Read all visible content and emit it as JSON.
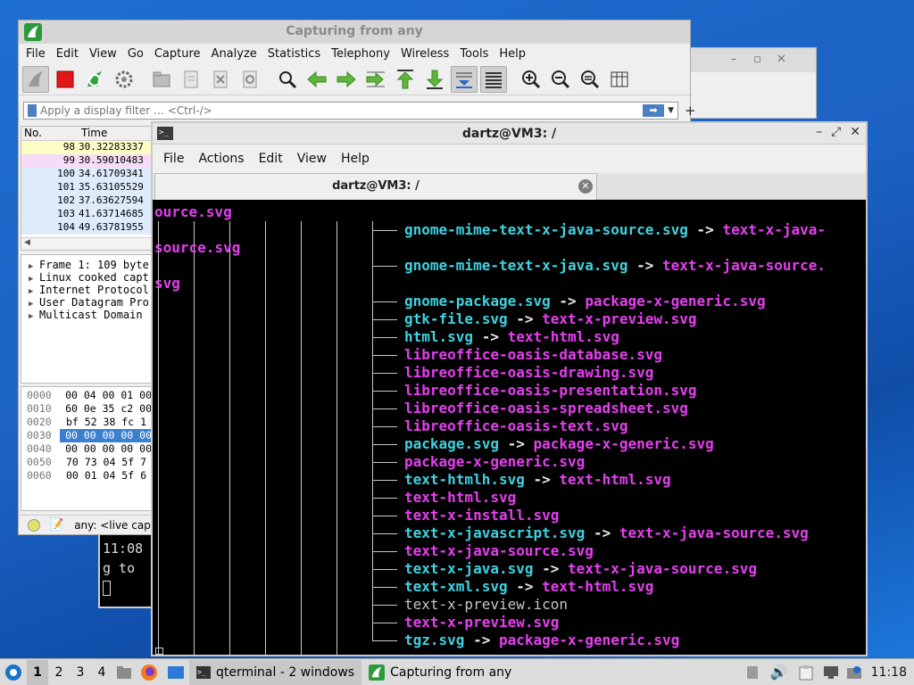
{
  "wireshark": {
    "title": "Capturing from any",
    "menu": [
      "File",
      "Edit",
      "View",
      "Go",
      "Capture",
      "Analyze",
      "Statistics",
      "Telephony",
      "Wireless",
      "Tools",
      "Help"
    ],
    "filter_placeholder": "Apply a display filter … <Ctrl-/>",
    "columns": [
      "No.",
      "Time"
    ],
    "packets": [
      {
        "no": "98",
        "time": "30.32283337",
        "color": "#fdfdc6"
      },
      {
        "no": "99",
        "time": "30.59010483",
        "color": "#f6dcf6"
      },
      {
        "no": "100",
        "time": "34.61709341",
        "color": "#ddebfb"
      },
      {
        "no": "101",
        "time": "35.63105529",
        "color": "#ddebfb"
      },
      {
        "no": "102",
        "time": "37.63627594",
        "color": "#ddebfb"
      },
      {
        "no": "103",
        "time": "41.63714685",
        "color": "#ddebfb"
      },
      {
        "no": "104",
        "time": "49.63781955",
        "color": "#ddebfb"
      }
    ],
    "details": [
      "Frame 1: 109 byte",
      "Linux cooked capt",
      "Internet Protocol",
      "User Datagram Pro",
      "Multicast Domain"
    ],
    "bytes": [
      {
        "off": "0000",
        "hex": "00 04 00 01 00"
      },
      {
        "off": "0010",
        "hex": "60 0e 35 c2 00"
      },
      {
        "off": "0020",
        "hex": "bf 52 38 fc 1"
      },
      {
        "off": "0030",
        "hex": "00 00 00 00 00",
        "sel": true
      },
      {
        "off": "0040",
        "hex": "00 00 00 00 00"
      },
      {
        "off": "0050",
        "hex": "70 73 04 5f 7"
      },
      {
        "off": "0060",
        "hex": "00 01 04 5f 6"
      }
    ],
    "status_text": "any: <live cap"
  },
  "bg_terminal": {
    "line1": "11:08",
    "line2": "g to"
  },
  "qterminal": {
    "title": "dartz@VM3: /",
    "menu": [
      "File",
      "Actions",
      "Edit",
      "View",
      "Help"
    ],
    "tab_label": "dartz@VM3: /",
    "lines": [
      {
        "link": "",
        "target": "ource.svg",
        "cont": true
      },
      {
        "link": "gnome-mime-text-x-java-source.svg",
        "target": "text-x-java-"
      },
      {
        "link": "",
        "target": "source.svg",
        "cont": true
      },
      {
        "link": "gnome-mime-text-x-java.svg",
        "target": "text-x-java-source."
      },
      {
        "link": "",
        "target": "svg",
        "cont": true
      },
      {
        "link": "gnome-package.svg",
        "target": "package-x-generic.svg"
      },
      {
        "link": "gtk-file.svg",
        "target": "text-x-preview.svg"
      },
      {
        "link": "html.svg",
        "target": "text-html.svg"
      },
      {
        "file": "libreoffice-oasis-database.svg"
      },
      {
        "file": "libreoffice-oasis-drawing.svg"
      },
      {
        "file": "libreoffice-oasis-presentation.svg"
      },
      {
        "file": "libreoffice-oasis-spreadsheet.svg"
      },
      {
        "file": "libreoffice-oasis-text.svg"
      },
      {
        "link": "package.svg",
        "target": "package-x-generic.svg"
      },
      {
        "file": "package-x-generic.svg"
      },
      {
        "link": "text-htmlh.svg",
        "target": "text-html.svg"
      },
      {
        "file": "text-html.svg"
      },
      {
        "file": "text-x-install.svg"
      },
      {
        "link": "text-x-javascript.svg",
        "target": "text-x-java-source.svg"
      },
      {
        "file": "text-x-java-source.svg"
      },
      {
        "link": "text-x-java.svg",
        "target": "text-x-java-source.svg"
      },
      {
        "link": "text-xml.svg",
        "target": "text-html.svg"
      },
      {
        "plain": "text-x-preview.icon"
      },
      {
        "file": "text-x-preview.svg"
      },
      {
        "link": "tgz.svg",
        "target": "package-x-generic.svg"
      }
    ],
    "arrow": "->"
  },
  "taskbar": {
    "workspaces": [
      "1",
      "2",
      "3",
      "4"
    ],
    "tasks": [
      "qterminal - 2 windows",
      "Capturing from any"
    ],
    "clock": "11:18"
  },
  "colors": {
    "link": "#3fd2e0",
    "file": "#e63ff0",
    "desktop": "#1c62c4"
  }
}
